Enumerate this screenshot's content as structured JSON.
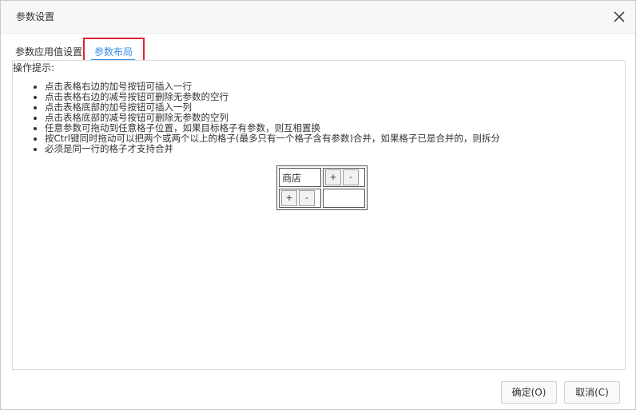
{
  "dialog": {
    "title": "参数设置",
    "close_icon": "close-icon"
  },
  "tabs": [
    {
      "label": "参数应用值设置",
      "active": false
    },
    {
      "label": "参数布局",
      "active": true
    }
  ],
  "colors": {
    "accent": "#3a8ee6",
    "highlight_border": "#e0262d"
  },
  "panel": {
    "hint_title": "操作提示:",
    "hints": [
      "点击表格右边的加号按钮可插入一行",
      "点击表格右边的减号按钮可删除无参数的空行",
      "点击表格底部的加号按钮可插入一列",
      "点击表格底部的减号按钮可删除无参数的空列",
      "任意参数可拖动到任意格子位置，如果目标格子有参数，则互相置换",
      "按Ctrl键同时拖动可以把两个或两个以上的格子(最多只有一个格子含有参数)合并，如果格子已是合并的，则拆分",
      "必须是同一行的格子才支持合并"
    ],
    "grid": {
      "cell_label": "商店",
      "plus": "+",
      "minus": "-"
    }
  },
  "footer": {
    "ok_label": "确定(O)",
    "cancel_label": "取消(C)"
  }
}
